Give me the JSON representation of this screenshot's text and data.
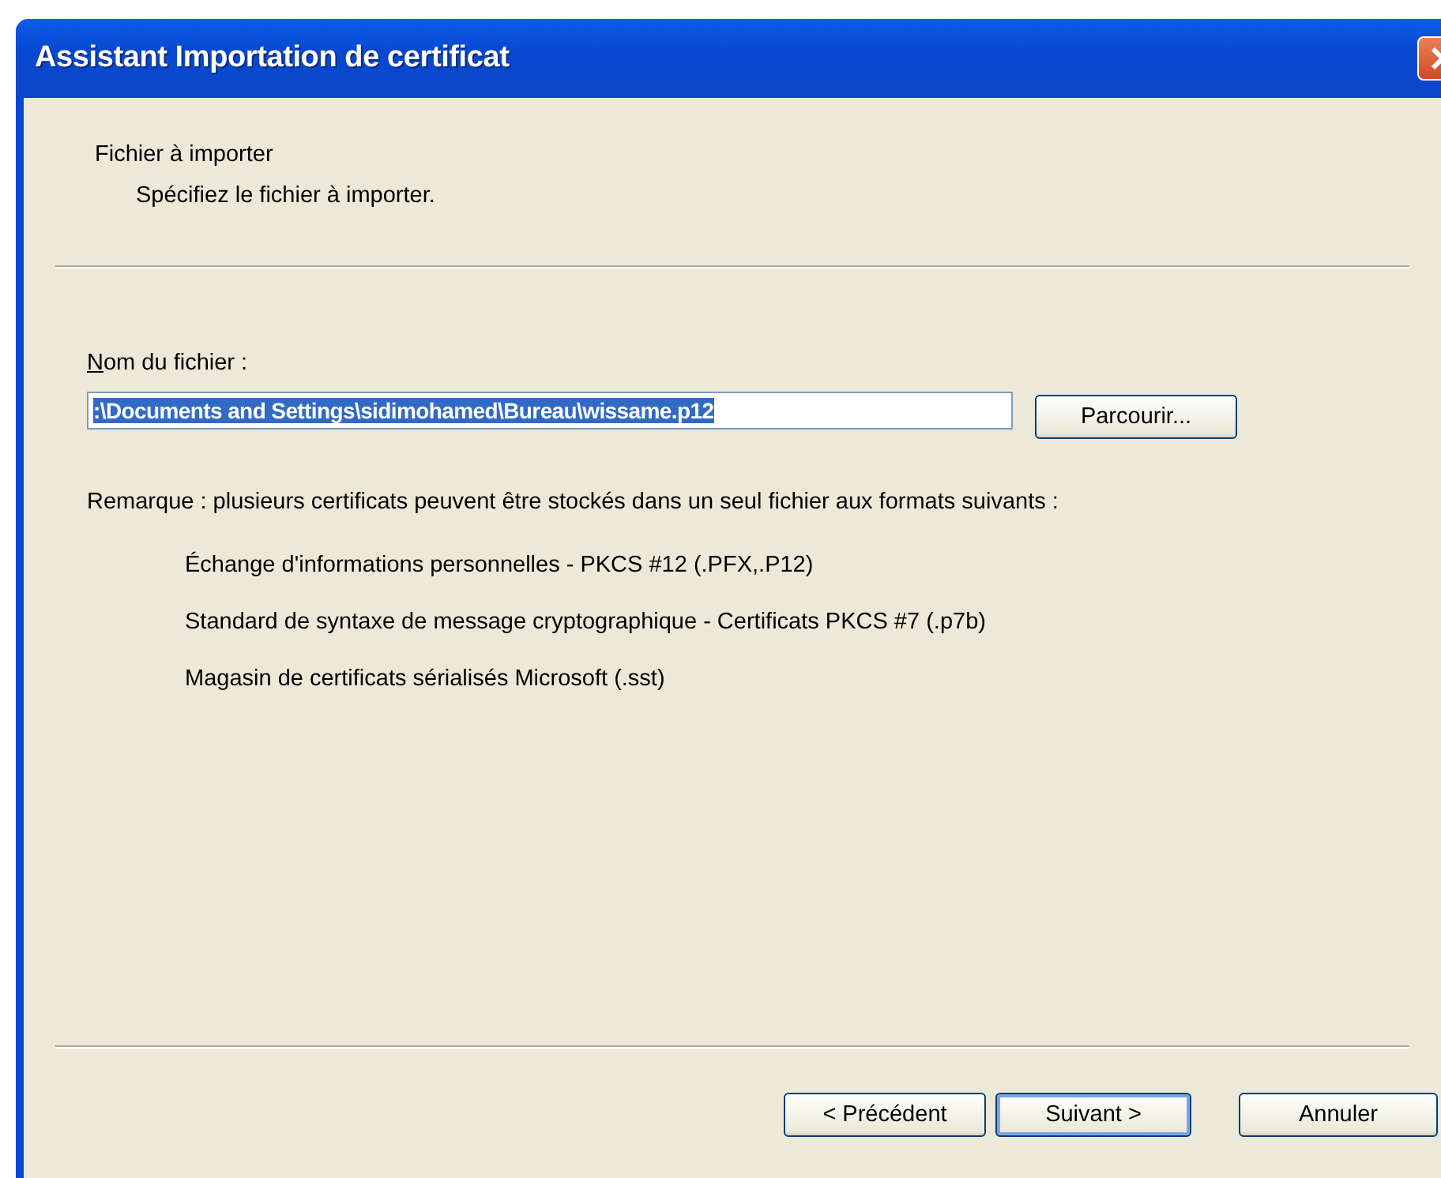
{
  "window": {
    "title": "Assistant Importation de certificat"
  },
  "header": {
    "title": "Fichier à importer",
    "subtitle": "Spécifiez le fichier à importer."
  },
  "file_field": {
    "label": "Nom du fichier :",
    "value": ":\\Documents and Settings\\sidimohamed\\Bureau\\wissame.p12",
    "selected": true
  },
  "browse_button": "Parcourir...",
  "remark": "Remarque : plusieurs certificats peuvent être stockés dans un seul fichier aux formats suivants :",
  "formats": [
    "Échange d'informations personnelles - PKCS #12 (.PFX,.P12)",
    "Standard de syntaxe de message cryptographique - Certificats PKCS #7 (.p7b)",
    "Magasin de certificats sérialisés Microsoft (.sst)"
  ],
  "buttons": [
    {
      "label": "< Précédent",
      "default": false
    },
    {
      "label": "Suivant >",
      "default": true
    },
    {
      "label": "Annuler",
      "default": false
    }
  ]
}
